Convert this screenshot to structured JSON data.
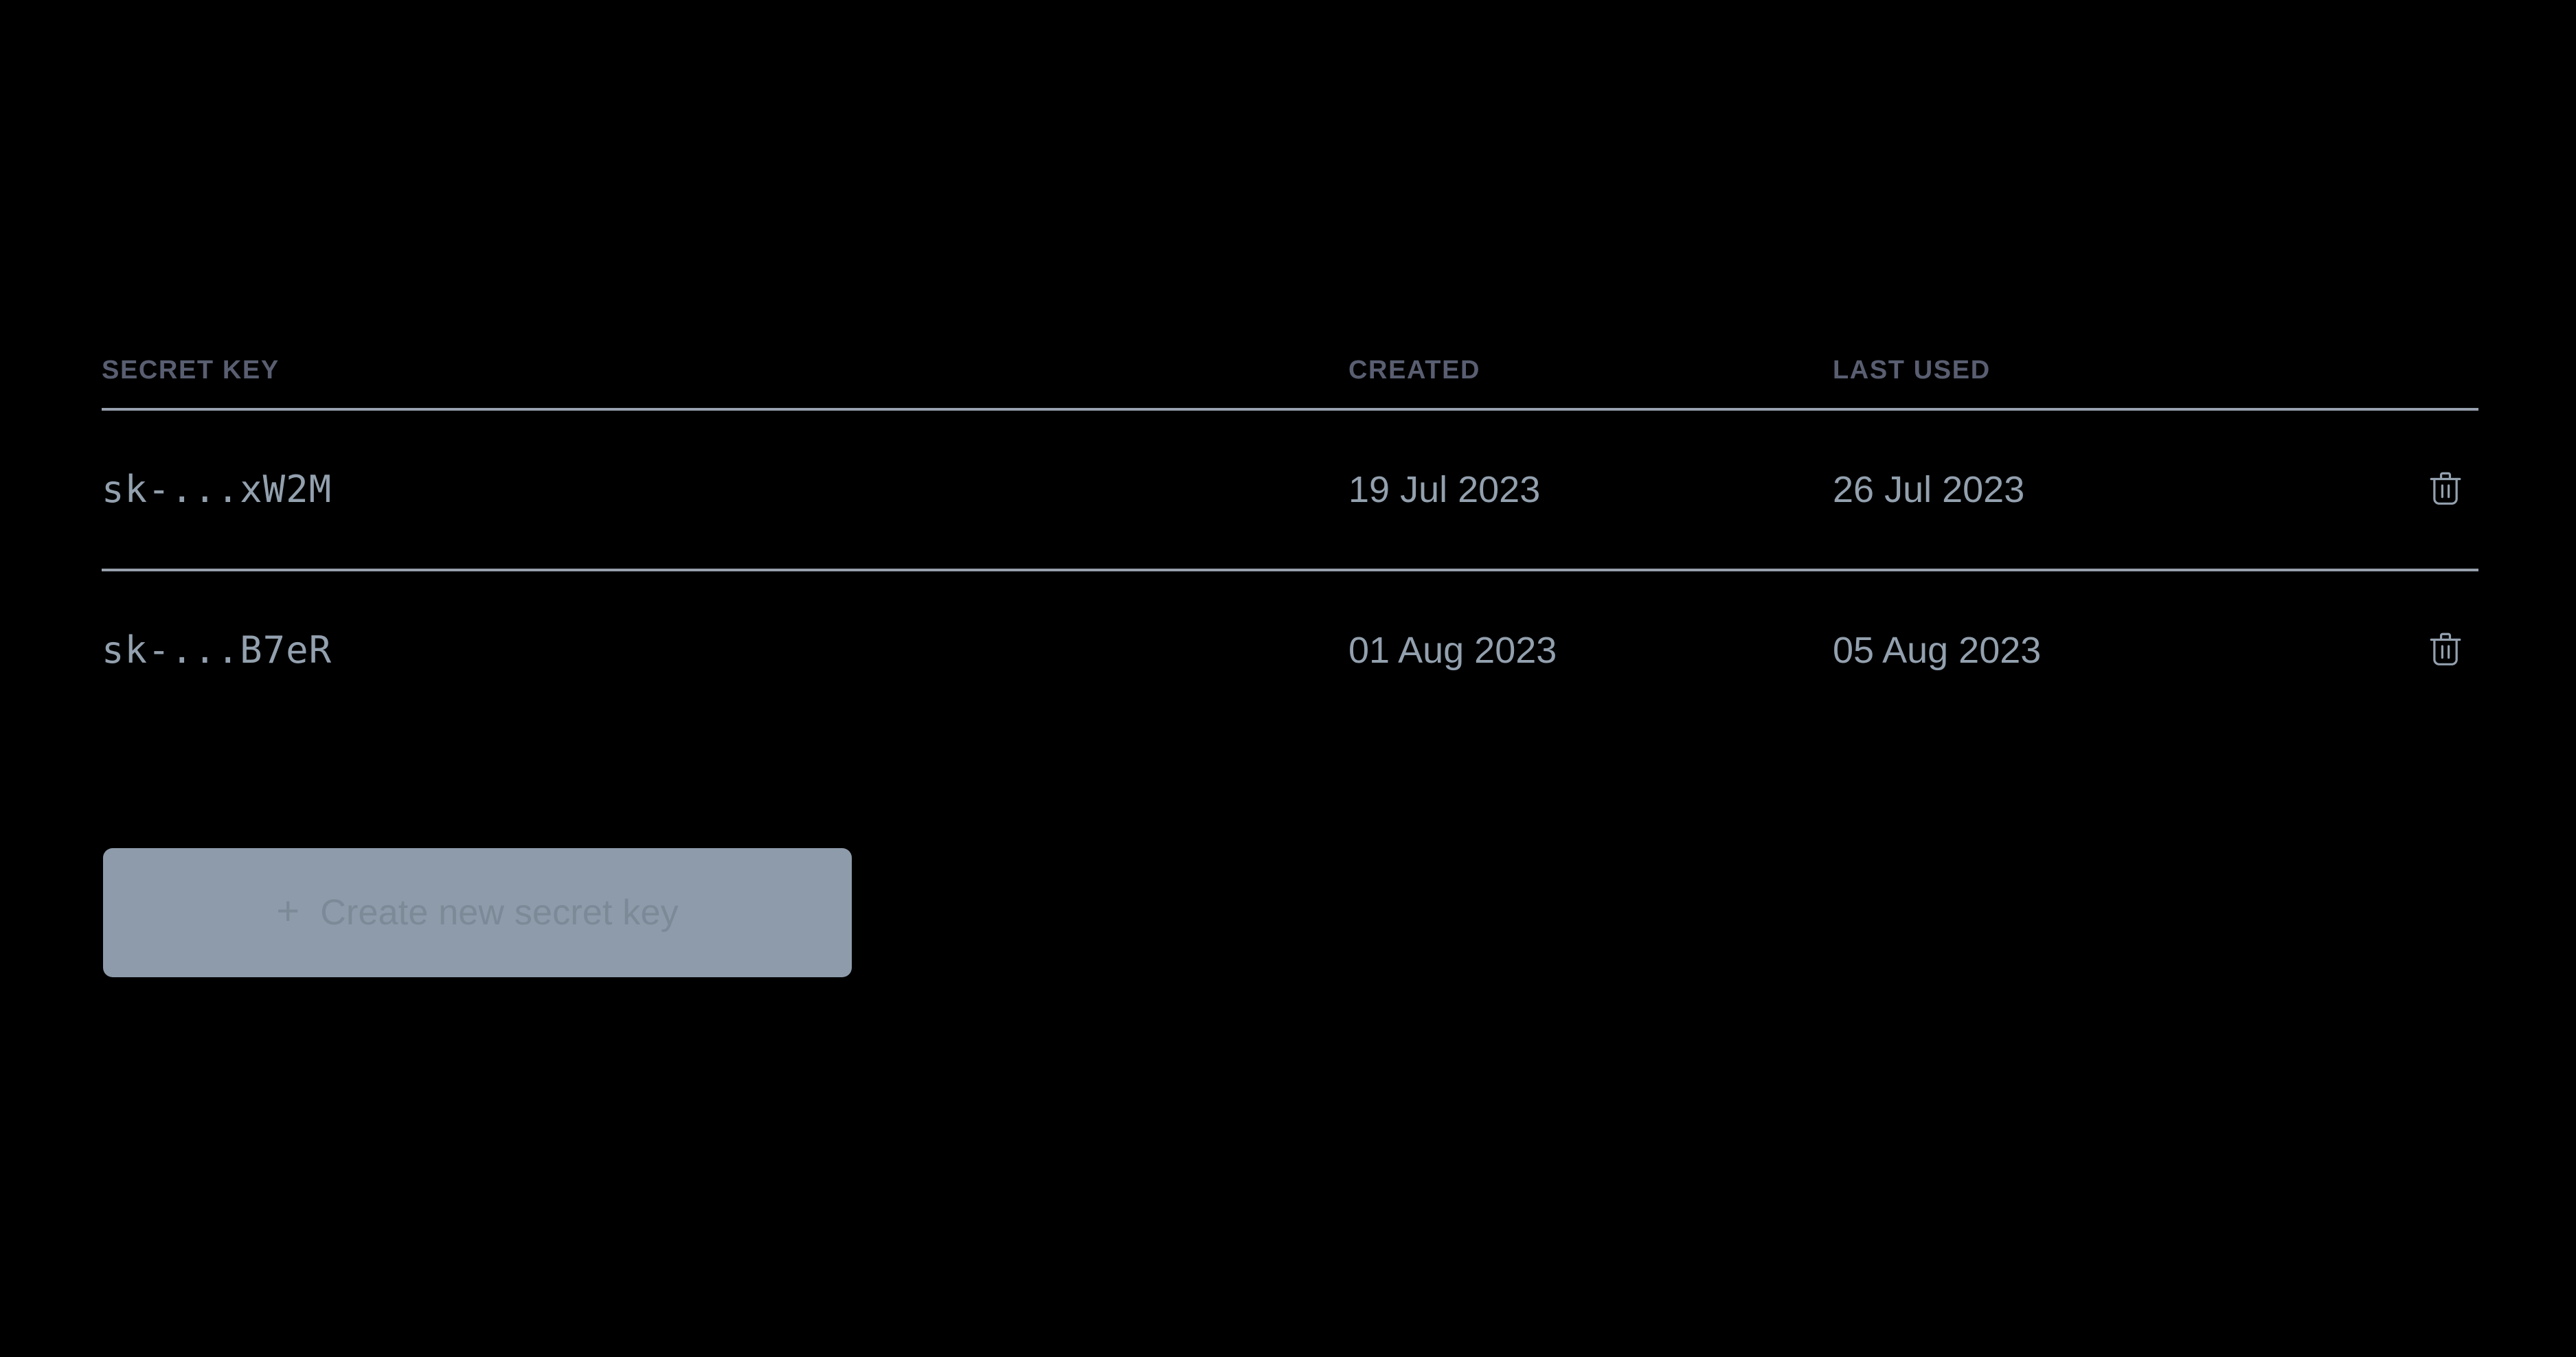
{
  "theme": {
    "background": "#000000",
    "header_text": "#595e71",
    "body_text": "#93a0ae",
    "divider": "#97a0ad",
    "button_bg": "#8d9baa",
    "button_text": "#7c8997"
  },
  "keys_table": {
    "columns": [
      {
        "id": "secret_key",
        "label": "SECRET KEY"
      },
      {
        "id": "created",
        "label": "CREATED"
      },
      {
        "id": "last_used",
        "label": "LAST USED"
      },
      {
        "id": "actions",
        "label": ""
      }
    ],
    "rows": [
      {
        "secret_key": "sk-...xW2M",
        "created": "19 Jul 2023",
        "last_used": "26 Jul 2023",
        "delete_icon": "trash-icon"
      },
      {
        "secret_key": "sk-...B7eR",
        "created": "01 Aug 2023",
        "last_used": "05 Aug 2023",
        "delete_icon": "trash-icon"
      }
    ]
  },
  "create_button": {
    "plus": "+",
    "label": "Create new secret key"
  }
}
